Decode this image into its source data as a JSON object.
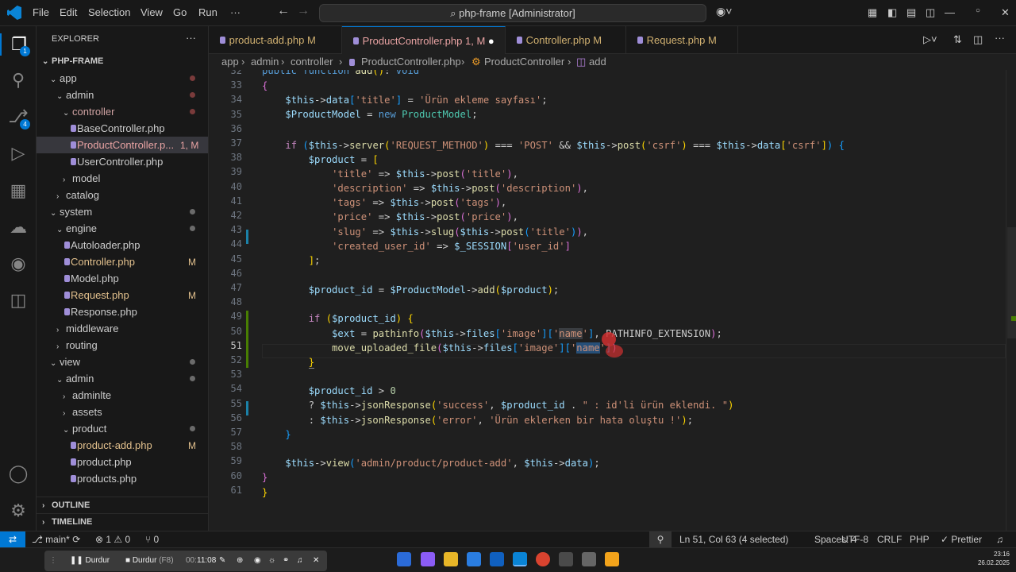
{
  "menu": [
    "File",
    "Edit",
    "Selection",
    "View",
    "Go",
    "Run",
    "···"
  ],
  "command_center": "⌕ php-frame [Administrator]",
  "explorer": {
    "title": "EXPLORER",
    "root": "PHP-FRAME",
    "items": [
      {
        "label": "app",
        "type": "folder-open"
      },
      {
        "label": "admin",
        "type": "folder-open"
      },
      {
        "label": "controller",
        "type": "folder-open"
      },
      {
        "label": "BaseController.php",
        "type": "file"
      },
      {
        "label": "ProductController.p...",
        "type": "file",
        "flag": "1, M"
      },
      {
        "label": "UserController.php",
        "type": "file"
      },
      {
        "label": "model",
        "type": "folder"
      },
      {
        "label": "catalog",
        "type": "folder"
      },
      {
        "label": "system",
        "type": "folder-open"
      },
      {
        "label": "engine",
        "type": "folder-open"
      },
      {
        "label": "Autoloader.php",
        "type": "file"
      },
      {
        "label": "Controller.php",
        "type": "file",
        "flag": "M"
      },
      {
        "label": "Model.php",
        "type": "file"
      },
      {
        "label": "Request.php",
        "type": "file",
        "flag": "M"
      },
      {
        "label": "Response.php",
        "type": "file"
      },
      {
        "label": "middleware",
        "type": "folder"
      },
      {
        "label": "routing",
        "type": "folder"
      },
      {
        "label": "view",
        "type": "folder-open"
      },
      {
        "label": "admin",
        "type": "folder-open"
      },
      {
        "label": "adminlte",
        "type": "folder"
      },
      {
        "label": "assets",
        "type": "folder"
      },
      {
        "label": "product",
        "type": "folder-open"
      },
      {
        "label": "product-add.php",
        "type": "file",
        "flag": "M"
      },
      {
        "label": "product.php",
        "type": "file"
      },
      {
        "label": "products.php",
        "type": "file"
      }
    ],
    "outline": "OUTLINE",
    "timeline": "TIMELINE"
  },
  "tabs": [
    {
      "label": "product-add.php",
      "flag": "M"
    },
    {
      "label": "ProductController.php",
      "flag": "1, M"
    },
    {
      "label": "Controller.php",
      "flag": "M"
    },
    {
      "label": "Request.php",
      "flag": "M"
    }
  ],
  "breadcrumb": [
    "app",
    "admin",
    "controller",
    "ProductController.php",
    "ProductController",
    "add"
  ],
  "line_numbers": [
    "32",
    "33",
    "34",
    "35",
    "36",
    "37",
    "38",
    "39",
    "40",
    "41",
    "42",
    "43",
    "44",
    "45",
    "46",
    "47",
    "48",
    "49",
    "50",
    "51",
    "52",
    "53",
    "54",
    "55",
    "56",
    "57",
    "58",
    "59",
    "60",
    "61"
  ],
  "status": {
    "branch": "main*",
    "problems": "⊗ 1 ⚠ 0",
    "ports": "⑂ 0",
    "position": "Ln 51, Col 63 (4 selected)",
    "spaces": "Spaces: 4",
    "encoding": "UTF-8",
    "eol": "CRLF",
    "language": "PHP",
    "prettier": "✓ Prettier"
  },
  "debug_bar": {
    "pause1": "Durdur",
    "pause2": "Durdur",
    "key": "(F8)",
    "time": "11:08"
  },
  "clock": {
    "time": "23:16",
    "date": "26.02.2025"
  },
  "badges": {
    "explorer": "1",
    "scm": "4"
  }
}
